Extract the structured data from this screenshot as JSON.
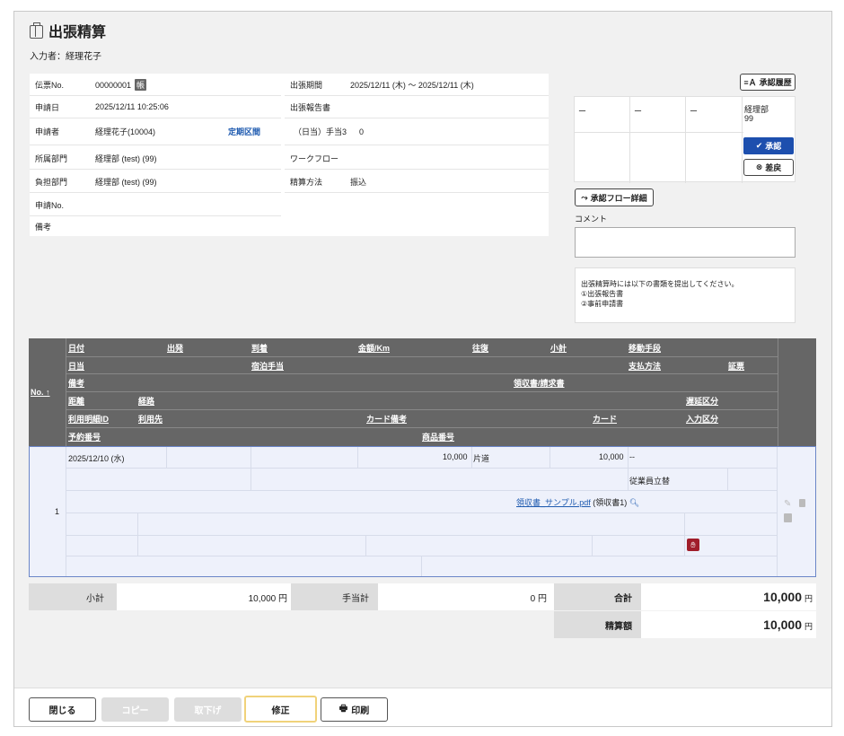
{
  "title": "出張精算",
  "inputter": "入力者：経理花子",
  "info": {
    "denpyo_label": "伝票No.",
    "denpyo_value": "00000001",
    "denpyo_icon": "帳",
    "shinsei_date_label": "申請日",
    "shinsei_date_value": "2025/12/11 10:25:06",
    "shinseisha_label": "申請者",
    "shinseisha_value": "経理花子(10004)",
    "teiki_link": "定期区間",
    "shozoku_label": "所属部門",
    "shozoku_value": "経理部 (test) (99)",
    "futan_label": "負担部門",
    "futan_value": "経理部 (test) (99)",
    "shinsei_no_label": "申請No.",
    "biko_label": "備考",
    "kikan_label": "出張期間",
    "kikan_value": "2025/12/11 (木) ～ 2025/12/11 (木)",
    "hokoku_label": "出張報告書",
    "teate_label": "（日当）手当3",
    "teate_value": "0",
    "workflow_label": "ワークフロー",
    "seisan_label": "精算方法",
    "seisan_value": "振込"
  },
  "approval": {
    "history_button": "承認履歴",
    "cells": [
      "ー",
      "ー",
      "ー"
    ],
    "dept": "経理部",
    "dept_code": "99",
    "approve_button": "承認",
    "reject_button": "差戻",
    "flow_button": "承認フロー詳細",
    "comment_label": "コメント",
    "note": [
      "出張精算時には以下の書類を提出してください。",
      "①出張報告書",
      "②事前申請書"
    ]
  },
  "table": {
    "no_header": "No.",
    "headers": {
      "date": "日付",
      "depart": "出発",
      "arrive": "到着",
      "amount_km": "金額/Km",
      "roundtrip": "往復",
      "subtotal": "小計",
      "transport": "移動手段",
      "nitto": "日当",
      "stay": "宿泊手当",
      "payment": "支払方法",
      "voucher": "証票",
      "remarks": "備考",
      "receipt": "領収書/請求書",
      "distance": "距離",
      "route": "経路",
      "delay": "遅延区分",
      "usage_id": "利用明細ID",
      "usage": "利用先",
      "card_remarks": "カード備考",
      "card": "カード",
      "input_type": "入力区分",
      "reservation": "予約番号",
      "product": "商品番号"
    },
    "row": {
      "no": "1",
      "date": "2025/12/10 (水)",
      "amount": "10,000",
      "roundtrip": "片道",
      "subtotal": "10,000",
      "transport": "--",
      "payment": "従業員立替",
      "receipt_file": "領収書_サンプル.pdf",
      "receipt_suffix": "(領収書1)"
    }
  },
  "totals": {
    "subtotal_label": "小計",
    "subtotal_value": "10,000 円",
    "teate_label": "手当計",
    "teate_value": "0 円",
    "total_label": "合計",
    "total_value": "10,000",
    "total_unit": "円",
    "seisan_label": "精算額",
    "seisan_value": "10,000",
    "seisan_unit": "円"
  },
  "footer": {
    "close": "閉じる",
    "copy": "コピー",
    "withdraw": "取下げ",
    "edit": "修正",
    "print": "印刷"
  },
  "colors": {
    "accent": "#1d4fae",
    "header": "#666666",
    "row_bg": "#eef1fb"
  }
}
